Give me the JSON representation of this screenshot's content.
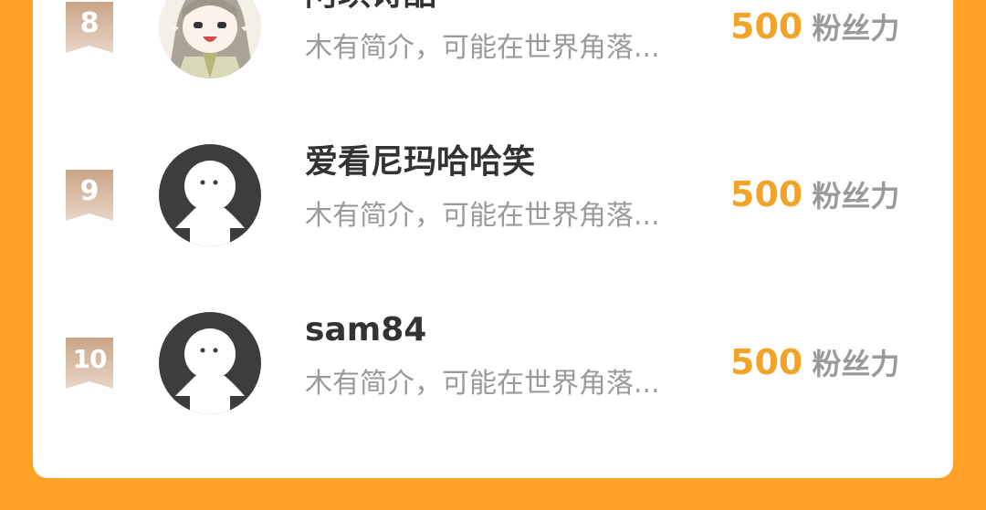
{
  "ranking": {
    "items": [
      {
        "rank": "8",
        "name": "阿琪诗酷",
        "bio": "木有简介，可能在世界角落...",
        "fans_value": "500",
        "fans_label": "粉丝力",
        "avatar": "anime-character-avatar"
      },
      {
        "rank": "9",
        "name": "爱看尼玛哈哈笑",
        "bio": "木有简介，可能在世界角落...",
        "fans_value": "500",
        "fans_label": "粉丝力",
        "avatar": "default-user-avatar"
      },
      {
        "rank": "10",
        "name": "sam84",
        "bio": "木有简介，可能在世界角落...",
        "fans_value": "500",
        "fans_label": "粉丝力",
        "avatar": "default-user-avatar"
      }
    ]
  },
  "colors": {
    "background": "#ffa225",
    "card": "#ffffff",
    "fans_value": "#f2a42a",
    "rank_badge": "#d8b79c",
    "avatar_default": "#3d3d3d"
  }
}
